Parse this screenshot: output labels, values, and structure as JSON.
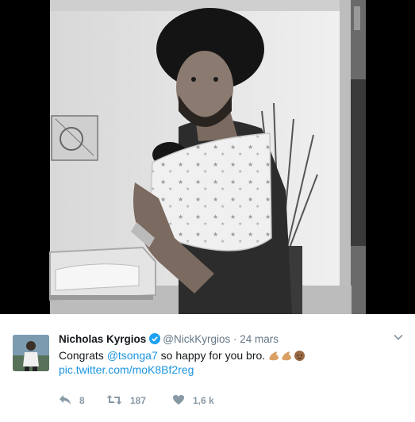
{
  "tweet": {
    "author_name": "Nicholas Kyrgios",
    "verified": true,
    "handle": "@NickKyrgios",
    "separator": "·",
    "timestamp": "24 mars",
    "text_before": "Congrats ",
    "mention": "@tsonga7",
    "text_after": " so happy for you bro. ",
    "emojis": [
      "flexed-biceps-emoji",
      "flexed-biceps-emoji",
      "baby-emoji"
    ],
    "link": "pic.twitter.com/moK8Bf2reg"
  },
  "actions": {
    "reply_count": "8",
    "retweet_count": "187",
    "like_count": "1,6 k"
  },
  "icons": {
    "reply": "reply-icon",
    "retweet": "retweet-icon",
    "like": "heart-icon",
    "menu": "chevron-down-icon",
    "verified": "verified-badge-icon"
  },
  "colors": {
    "link": "#1b95e0",
    "verified": "#1da1f2",
    "muted": "#657786",
    "action": "#8899a6"
  }
}
